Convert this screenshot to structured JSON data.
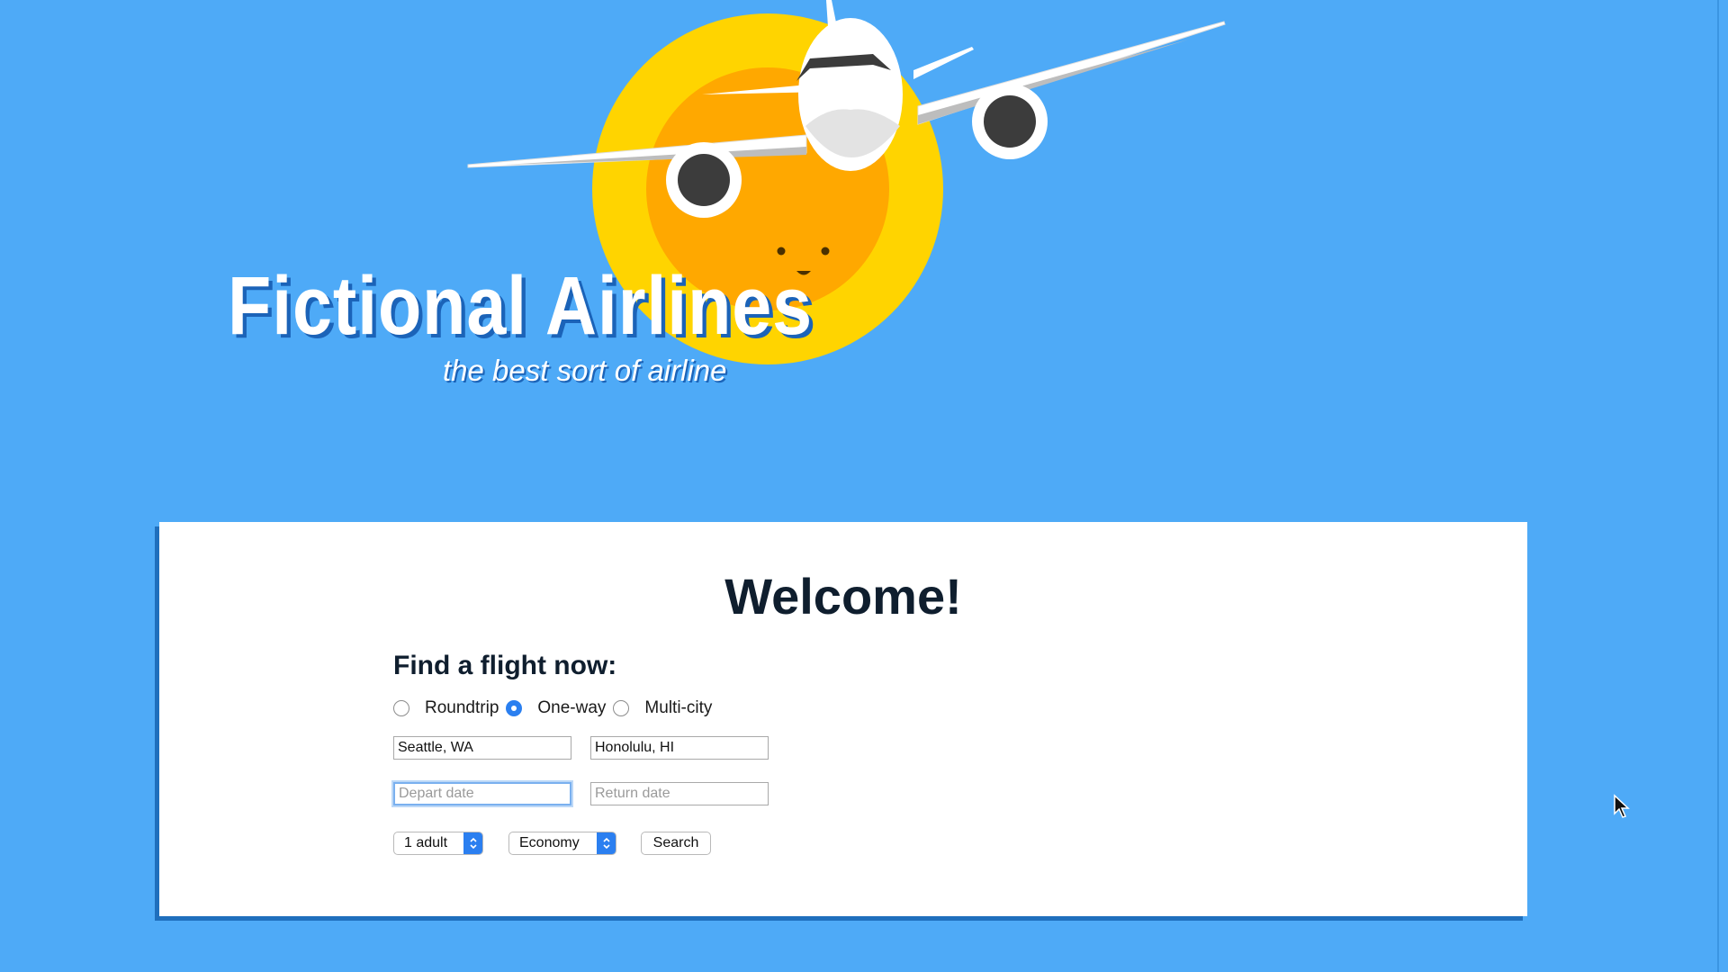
{
  "brand": {
    "name": "Fictional Airlines",
    "tagline": "the best sort of airline",
    "colors": {
      "background": "#4eaaf7",
      "sun_outer": "#ffd400",
      "sun_inner": "#ffa800",
      "text_shadow": "#1b63b8",
      "accent": "#2a7ff0"
    }
  },
  "main": {
    "welcome": "Welcome!",
    "search_form": {
      "heading": "Find a flight now:",
      "trip_types": [
        {
          "label": "Roundtrip",
          "selected": false
        },
        {
          "label": "One-way",
          "selected": true
        },
        {
          "label": "Multi-city",
          "selected": false
        }
      ],
      "from": {
        "value": "Seattle, WA",
        "placeholder": ""
      },
      "to": {
        "value": "Honolulu, HI",
        "placeholder": ""
      },
      "depart": {
        "value": "",
        "placeholder": "Depart date",
        "focused": true
      },
      "return": {
        "value": "",
        "placeholder": "Return date"
      },
      "passengers": {
        "selected": "1 adult"
      },
      "cabin_class": {
        "selected": "Economy"
      },
      "search_label": "Search"
    }
  },
  "icons": {
    "logo": "airplane-sun-logo",
    "select_arrows": "up-down-chevron-icon",
    "cursor": "mouse-pointer-icon"
  }
}
